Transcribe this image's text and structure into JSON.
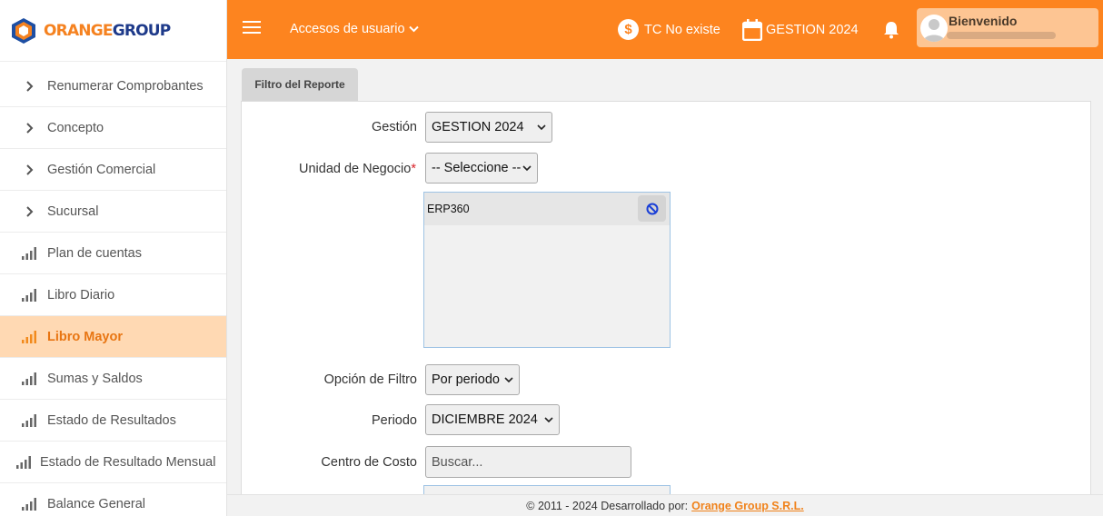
{
  "brand": {
    "name_part1": "ORANGE",
    "name_part2": "GROUP"
  },
  "sidebar": {
    "items": [
      {
        "label": "Renumerar Comprobantes",
        "icon": "chevron-right-icon"
      },
      {
        "label": "Concepto",
        "icon": "chevron-right-icon"
      },
      {
        "label": "Gestión Comercial",
        "icon": "chevron-right-icon"
      },
      {
        "label": "Sucursal",
        "icon": "chevron-right-icon"
      },
      {
        "label": "Plan de cuentas",
        "icon": "bar-chart-icon"
      },
      {
        "label": "Libro Diario",
        "icon": "bar-chart-icon"
      },
      {
        "label": "Libro Mayor",
        "icon": "bar-chart-icon",
        "active": true
      },
      {
        "label": "Sumas y Saldos",
        "icon": "bar-chart-icon"
      },
      {
        "label": "Estado de Resultados",
        "icon": "bar-chart-icon"
      },
      {
        "label": "Estado de Resultado Mensual",
        "icon": "bar-chart-icon"
      },
      {
        "label": "Balance General",
        "icon": "bar-chart-icon"
      }
    ]
  },
  "header": {
    "menu_icon": "hamburger-icon",
    "accesos_label": "Accesos de usuario",
    "tc_label": "TC No existe",
    "gestion_label": "GESTION 2024",
    "user_greeting": "Bienvenido",
    "accent_color": "#fd841f"
  },
  "content": {
    "tab_label": "Filtro del Reporte",
    "gestion_label": "Gestión",
    "gestion_value": "GESTION 2024",
    "unidad_label": "Unidad de Negocio",
    "unidad_required_mark": "*",
    "unidad_value": "-- Seleccione --",
    "selected_units": [
      "ERP360"
    ],
    "opcion_label": "Opción de Filtro",
    "opcion_value": "Por periodo",
    "periodo_label": "Periodo",
    "periodo_value": "DICIEMBRE 2024",
    "centro_label": "Centro de Costo",
    "centro_placeholder": "Buscar..."
  },
  "footer": {
    "text": "© 2011 - 2024 Desarrollado por:",
    "link": "Orange Group S.R.L."
  }
}
